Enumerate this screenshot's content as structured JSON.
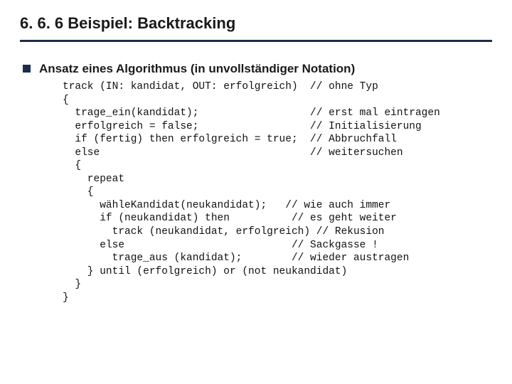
{
  "title": "6. 6. 6  Beispiel: Backtracking",
  "bullet": "Ansatz eines Algorithmus (in unvollständiger Notation)",
  "code": "track (IN: kandidat, OUT: erfolgreich)  // ohne Typ\n{\n  trage_ein(kandidat);                  // erst mal eintragen\n  erfolgreich = false;                  // Initialisierung\n  if (fertig) then erfolgreich = true;  // Abbruchfall\n  else                                  // weitersuchen\n  {\n    repeat\n    {\n      wähleKandidat(neukandidat);   // wie auch immer\n      if (neukandidat) then          // es geht weiter\n        track (neukandidat, erfolgreich) // Rekusion\n      else                           // Sackgasse !\n        trage_aus (kandidat);        // wieder austragen\n    } until (erfolgreich) or (not neukandidat)\n  }\n}"
}
